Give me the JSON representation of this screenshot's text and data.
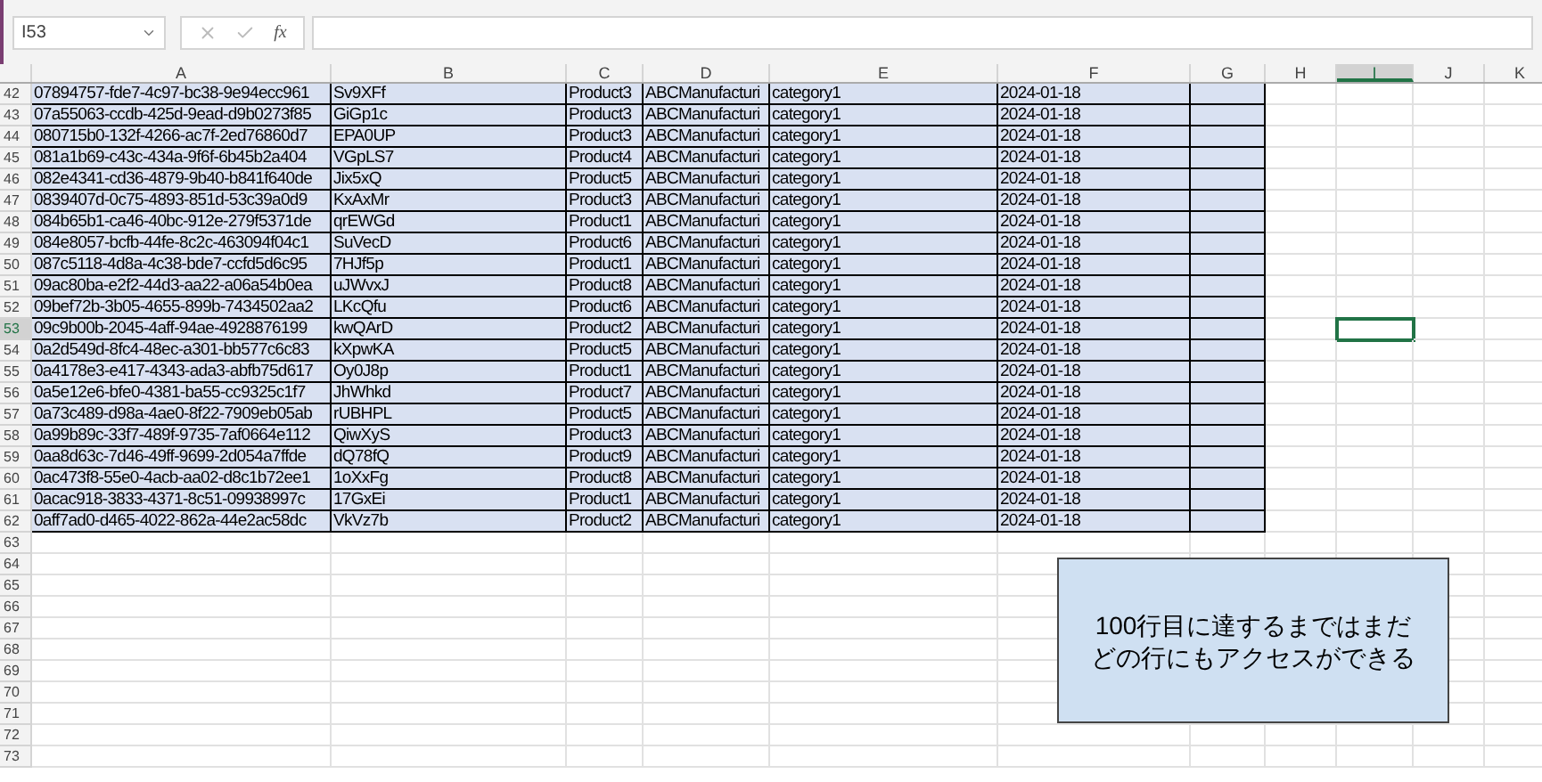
{
  "formula_bar": {
    "name_box": "I53",
    "function_label": "fx"
  },
  "columns": [
    {
      "label": "A",
      "selected": false
    },
    {
      "label": "B",
      "selected": false
    },
    {
      "label": "C",
      "selected": false
    },
    {
      "label": "D",
      "selected": false
    },
    {
      "label": "E",
      "selected": false
    },
    {
      "label": "F",
      "selected": false
    },
    {
      "label": "G",
      "selected": false
    },
    {
      "label": "H",
      "selected": false
    },
    {
      "label": "I",
      "selected": true
    },
    {
      "label": "J",
      "selected": false
    },
    {
      "label": "K",
      "selected": false
    }
  ],
  "rows": [
    {
      "number": "42",
      "selected": false,
      "highlighted": true,
      "cells": [
        "07894757-fde7-4c97-bc38-9e94ecc961",
        "Sv9XFf",
        "Product3",
        "ABCManufacturi",
        "category1",
        "2024-01-18"
      ]
    },
    {
      "number": "43",
      "selected": false,
      "highlighted": true,
      "cells": [
        "07a55063-ccdb-425d-9ead-d9b0273f85",
        "GiGp1c",
        "Product3",
        "ABCManufacturi",
        "category1",
        "2024-01-18"
      ]
    },
    {
      "number": "44",
      "selected": false,
      "highlighted": true,
      "cells": [
        "080715b0-132f-4266-ac7f-2ed76860d7",
        "EPA0UP",
        "Product3",
        "ABCManufacturi",
        "category1",
        "2024-01-18"
      ]
    },
    {
      "number": "45",
      "selected": false,
      "highlighted": true,
      "cells": [
        "081a1b69-c43c-434a-9f6f-6b45b2a404",
        "VGpLS7",
        "Product4",
        "ABCManufacturi",
        "category1",
        "2024-01-18"
      ]
    },
    {
      "number": "46",
      "selected": false,
      "highlighted": true,
      "cells": [
        "082e4341-cd36-4879-9b40-b841f640de",
        "Jix5xQ",
        "Product5",
        "ABCManufacturi",
        "category1",
        "2024-01-18"
      ]
    },
    {
      "number": "47",
      "selected": false,
      "highlighted": true,
      "cells": [
        "0839407d-0c75-4893-851d-53c39a0d9",
        "KxAxMr",
        "Product3",
        "ABCManufacturi",
        "category1",
        "2024-01-18"
      ]
    },
    {
      "number": "48",
      "selected": false,
      "highlighted": true,
      "cells": [
        "084b65b1-ca46-40bc-912e-279f5371de",
        "qrEWGd",
        "Product1",
        "ABCManufacturi",
        "category1",
        "2024-01-18"
      ]
    },
    {
      "number": "49",
      "selected": false,
      "highlighted": true,
      "cells": [
        "084e8057-bcfb-44fe-8c2c-463094f04c1",
        "SuVecD",
        "Product6",
        "ABCManufacturi",
        "category1",
        "2024-01-18"
      ]
    },
    {
      "number": "50",
      "selected": false,
      "highlighted": true,
      "cells": [
        "087c5118-4d8a-4c38-bde7-ccfd5d6c95",
        "7HJf5p",
        "Product1",
        "ABCManufacturi",
        "category1",
        "2024-01-18"
      ]
    },
    {
      "number": "51",
      "selected": false,
      "highlighted": true,
      "cells": [
        "09ac80ba-e2f2-44d3-aa22-a06a54b0ea",
        "uJWvxJ",
        "Product8",
        "ABCManufacturi",
        "category1",
        "2024-01-18"
      ]
    },
    {
      "number": "52",
      "selected": false,
      "highlighted": true,
      "cells": [
        "09bef72b-3b05-4655-899b-7434502aa2",
        "LKcQfu",
        "Product6",
        "ABCManufacturi",
        "category1",
        "2024-01-18"
      ]
    },
    {
      "number": "53",
      "selected": true,
      "highlighted": true,
      "cells": [
        "09c9b00b-2045-4aff-94ae-4928876199",
        "kwQArD",
        "Product2",
        "ABCManufacturi",
        "category1",
        "2024-01-18"
      ]
    },
    {
      "number": "54",
      "selected": false,
      "highlighted": true,
      "cells": [
        "0a2d549d-8fc4-48ec-a301-bb577c6c83",
        "kXpwKA",
        "Product5",
        "ABCManufacturi",
        "category1",
        "2024-01-18"
      ]
    },
    {
      "number": "55",
      "selected": false,
      "highlighted": true,
      "cells": [
        "0a4178e3-e417-4343-ada3-abfb75d617",
        "Oy0J8p",
        "Product1",
        "ABCManufacturi",
        "category1",
        "2024-01-18"
      ]
    },
    {
      "number": "56",
      "selected": false,
      "highlighted": true,
      "cells": [
        "0a5e12e6-bfe0-4381-ba55-cc9325c1f7",
        "JhWhkd",
        "Product7",
        "ABCManufacturi",
        "category1",
        "2024-01-18"
      ]
    },
    {
      "number": "57",
      "selected": false,
      "highlighted": true,
      "cells": [
        "0a73c489-d98a-4ae0-8f22-7909eb05ab",
        "rUBHPL",
        "Product5",
        "ABCManufacturi",
        "category1",
        "2024-01-18"
      ]
    },
    {
      "number": "58",
      "selected": false,
      "highlighted": true,
      "cells": [
        "0a99b89c-33f7-489f-9735-7af0664e112",
        "QiwXyS",
        "Product3",
        "ABCManufacturi",
        "category1",
        "2024-01-18"
      ]
    },
    {
      "number": "59",
      "selected": false,
      "highlighted": true,
      "cells": [
        "0aa8d63c-7d46-49ff-9699-2d054a7ffde",
        "dQ78fQ",
        "Product9",
        "ABCManufacturi",
        "category1",
        "2024-01-18"
      ]
    },
    {
      "number": "60",
      "selected": false,
      "highlighted": true,
      "cells": [
        "0ac473f8-55e0-4acb-aa02-d8c1b72ee1",
        "1oXxFg",
        "Product8",
        "ABCManufacturi",
        "category1",
        "2024-01-18"
      ]
    },
    {
      "number": "61",
      "selected": false,
      "highlighted": true,
      "cells": [
        "0acac918-3833-4371-8c51-09938997c",
        "17GxEi",
        "Product1",
        "ABCManufacturi",
        "category1",
        "2024-01-18"
      ]
    },
    {
      "number": "62",
      "selected": false,
      "highlighted": true,
      "cells": [
        "0aff7ad0-d465-4022-862a-44e2ac58dc",
        "VkVz7b",
        "Product2",
        "ABCManufacturi",
        "category1",
        "2024-01-18"
      ]
    },
    {
      "number": "63",
      "selected": false,
      "highlighted": false,
      "cells": []
    },
    {
      "number": "64",
      "selected": false,
      "highlighted": false,
      "cells": []
    },
    {
      "number": "65",
      "selected": false,
      "highlighted": false,
      "cells": []
    },
    {
      "number": "66",
      "selected": false,
      "highlighted": false,
      "cells": []
    },
    {
      "number": "67",
      "selected": false,
      "highlighted": false,
      "cells": []
    },
    {
      "number": "68",
      "selected": false,
      "highlighted": false,
      "cells": []
    },
    {
      "number": "69",
      "selected": false,
      "highlighted": false,
      "cells": []
    },
    {
      "number": "70",
      "selected": false,
      "highlighted": false,
      "cells": []
    },
    {
      "number": "71",
      "selected": false,
      "highlighted": false,
      "cells": []
    },
    {
      "number": "72",
      "selected": false,
      "highlighted": false,
      "cells": []
    },
    {
      "number": "73",
      "selected": false,
      "highlighted": false,
      "cells": []
    }
  ],
  "callout": {
    "lines": [
      "100行目に達するまではまだ",
      "どの行にもアクセスができる"
    ]
  }
}
